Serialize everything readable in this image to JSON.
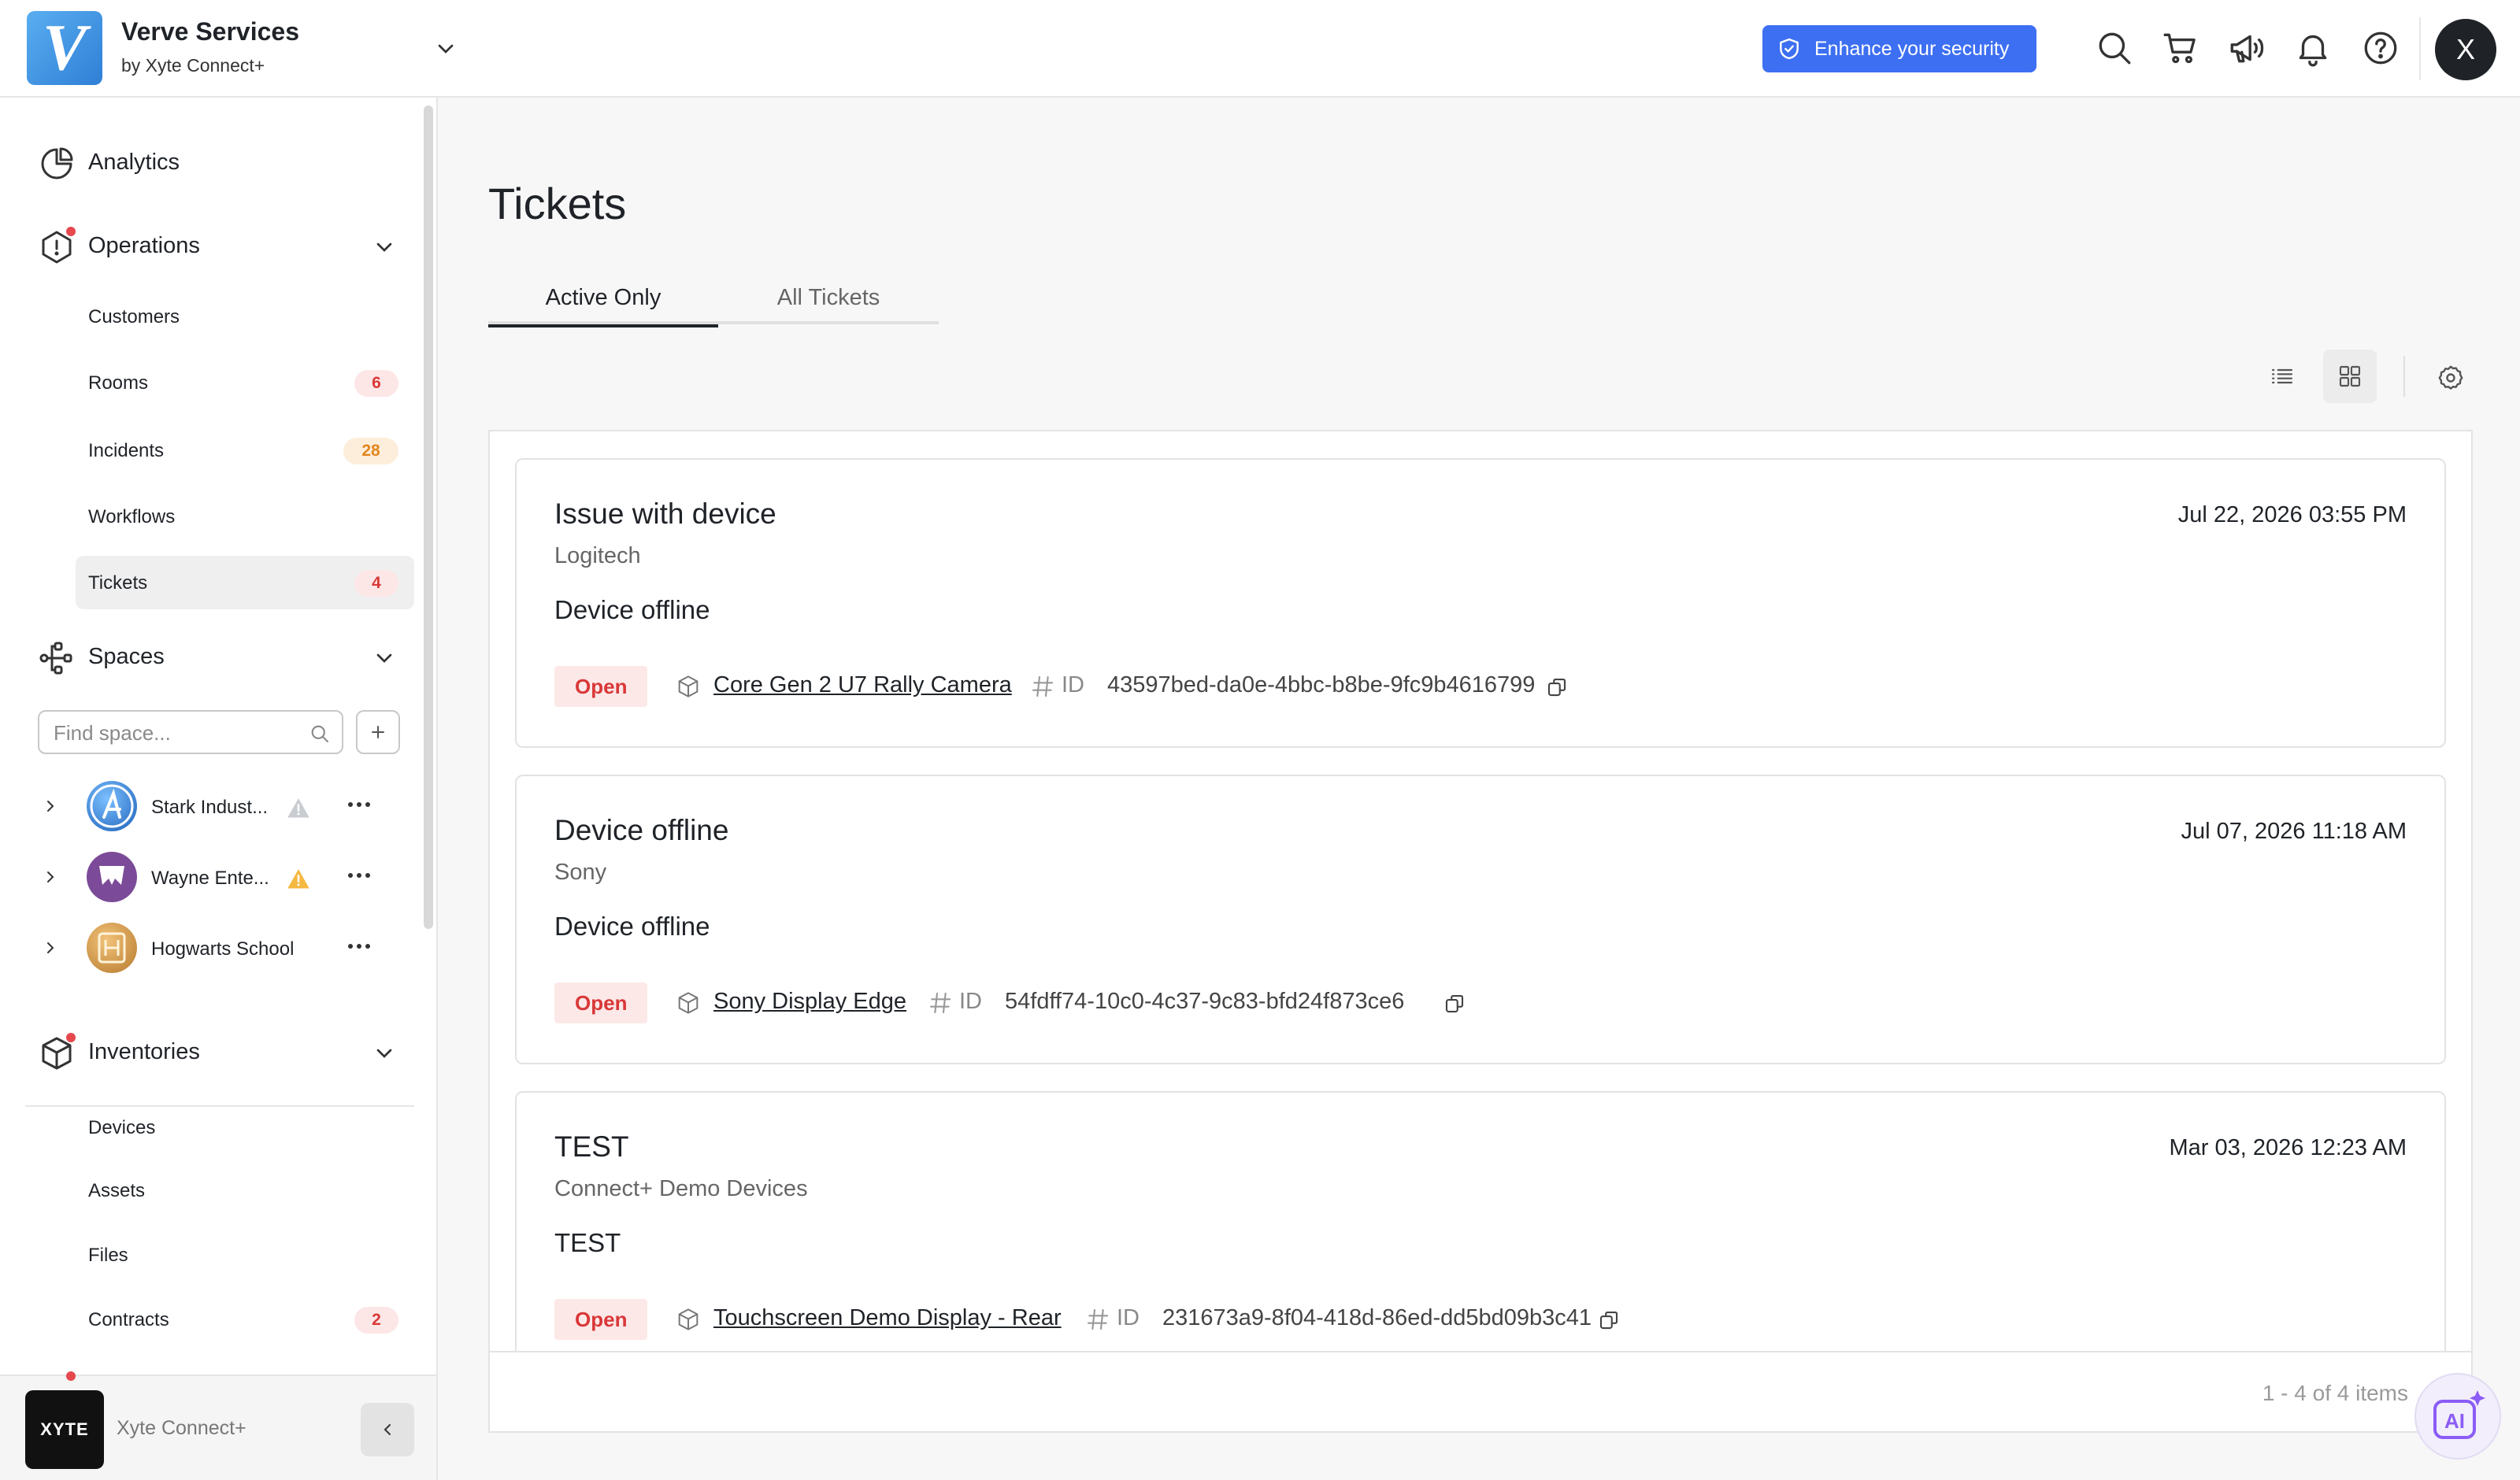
{
  "header": {
    "logo_letter": "V",
    "org_name": "Verve Services",
    "org_sub": "by Xyte Connect+",
    "security_label": "Enhance your security",
    "avatar_initial": "X",
    "icons": [
      "search-icon",
      "cart-icon",
      "megaphone-icon",
      "bell-icon",
      "help-icon"
    ]
  },
  "sidebar": {
    "analytics_label": "Analytics",
    "operations": {
      "label": "Operations",
      "items": [
        {
          "label": "Customers",
          "badge": ""
        },
        {
          "label": "Rooms",
          "badge": "6"
        },
        {
          "label": "Incidents",
          "badge": "28"
        },
        {
          "label": "Workflows",
          "badge": ""
        },
        {
          "label": "Tickets",
          "badge": "4"
        }
      ]
    },
    "spaces": {
      "label": "Spaces",
      "search_placeholder": "Find space...",
      "items": [
        {
          "label": "Stark Indust..."
        },
        {
          "label": "Wayne Ente..."
        },
        {
          "label": "Hogwarts School"
        }
      ]
    },
    "inventories": {
      "label": "Inventories",
      "items": [
        {
          "label": "Devices",
          "badge": ""
        },
        {
          "label": "Assets",
          "badge": ""
        },
        {
          "label": "Files",
          "badge": ""
        },
        {
          "label": "Contracts",
          "badge": "2"
        }
      ]
    },
    "footer": {
      "logo_text": "XYTE",
      "label": "Xyte Connect+"
    }
  },
  "main": {
    "title": "Tickets",
    "tabs": [
      {
        "label": "Active Only",
        "active": true
      },
      {
        "label": "All Tickets",
        "active": false
      }
    ],
    "tickets": [
      {
        "title": "Issue with device",
        "company": "Logitech",
        "date": "Jul 22, 2026 03:55 PM",
        "description": "Device offline",
        "status": "Open",
        "device": "Core Gen 2 U7 Rally Camera",
        "id_label": "ID",
        "id": "43597bed-da0e-4bbc-b8be-9fc9b4616799"
      },
      {
        "title": "Device offline",
        "company": "Sony",
        "date": "Jul 07, 2026 11:18 AM",
        "description": "Device offline",
        "status": "Open",
        "device": "Sony Display Edge",
        "id_label": "ID",
        "id": "54fdff74-10c0-4c37-9c83-bfd24f873ce6"
      },
      {
        "title": "TEST",
        "company": "Connect+ Demo Devices",
        "date": "Mar 03, 2026 12:23 AM",
        "description": "TEST",
        "status": "Open",
        "device": "Touchscreen Demo Display - Rear",
        "id_label": "ID",
        "id": "231673a9-8f04-418d-86ed-dd5bd09b3c41"
      }
    ],
    "pagination": "1 - 4 of 4 items",
    "ai_label": "AI"
  },
  "colors": {
    "accent": "#3d6ff2",
    "status_open_bg": "#fde8e8",
    "status_open_text": "#d93838",
    "badge_orange": "#e3861d"
  }
}
